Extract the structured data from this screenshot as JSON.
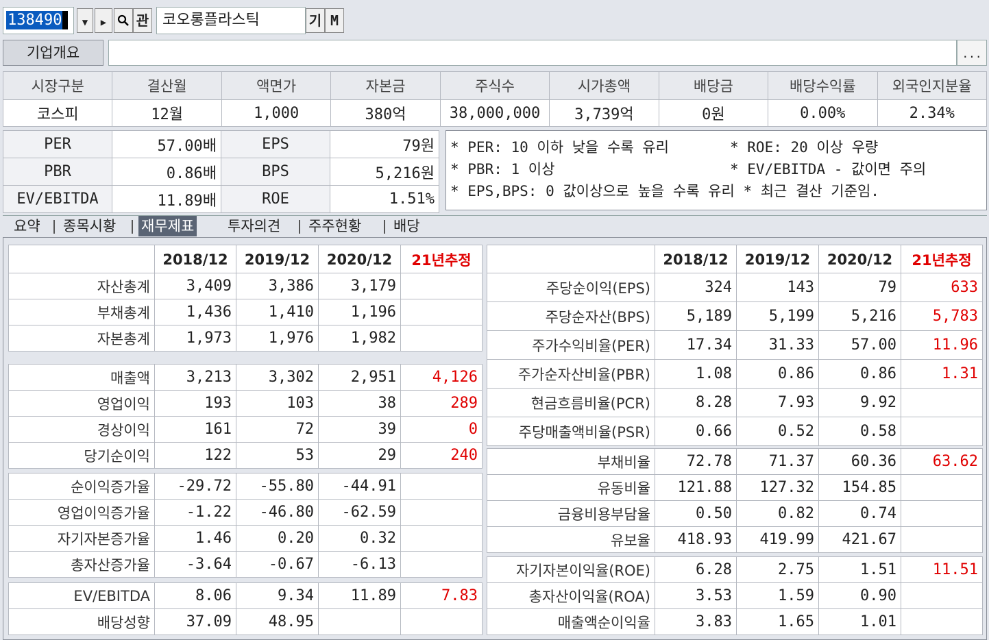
{
  "top": {
    "stock_code": "138490",
    "company_name": "코오롱플라스틱",
    "search_icon": "magnifier-icon",
    "btn_gwan": "관",
    "btn_gi": "기",
    "btn_m": "M"
  },
  "corp": {
    "label": "기업개요",
    "value": "",
    "more": "..."
  },
  "market": {
    "headers": [
      "시장구분",
      "결산월",
      "액면가",
      "자본금",
      "주식수",
      "시가총액",
      "배당금",
      "배당수익률",
      "외국인지분율"
    ],
    "values": [
      "코스피",
      "12월",
      "1,000",
      "380억",
      "38,000,000",
      "3,739억",
      "0원",
      "0.00%",
      "2.34%"
    ]
  },
  "valuation": [
    {
      "l1": "PER",
      "v1": "57.00배",
      "l2": "EPS",
      "v2": "79원"
    },
    {
      "l1": "PBR",
      "v1": "0.86배",
      "l2": "BPS",
      "v2": "5,216원"
    },
    {
      "l1": "EV/EBITDA",
      "v1": "11.89배",
      "l2": "ROE",
      "v2": "1.51%"
    }
  ],
  "notes": {
    "n1": "* PER: 10 이하 낮을 수록 유리",
    "n2": "* ROE: 20 이상 우량",
    "n3": "* PBR: 1 이상",
    "n4": "* EV/EBITDA - 값이면 주의",
    "n5": "* EPS,BPS: 0 값이상으로 높을 수록 유리 * 최근 결산 기준임."
  },
  "tabs": [
    "요약",
    "종목시황",
    "재무제표",
    "투자의견",
    "주주현황",
    "배당"
  ],
  "left": {
    "headers": [
      "",
      "2018/12",
      "2019/12",
      "2020/12",
      "21년추정"
    ],
    "g1": [
      [
        "자산총계",
        "3,409",
        "3,386",
        "3,179",
        ""
      ],
      [
        "부채총계",
        "1,436",
        "1,410",
        "1,196",
        ""
      ],
      [
        "자본총계",
        "1,973",
        "1,976",
        "1,982",
        ""
      ]
    ],
    "g2": [
      [
        "매출액",
        "3,213",
        "3,302",
        "2,951",
        "4,126"
      ],
      [
        "영업이익",
        "193",
        "103",
        "38",
        "289"
      ],
      [
        "경상이익",
        "161",
        "72",
        "39",
        "0"
      ],
      [
        "당기순이익",
        "122",
        "53",
        "29",
        "240"
      ]
    ],
    "g3": [
      [
        "순이익증가율",
        "-29.72",
        "-55.80",
        "-44.91",
        ""
      ],
      [
        "영업이익증가율",
        "-1.22",
        "-46.80",
        "-62.59",
        ""
      ],
      [
        "자기자본증가율",
        "1.46",
        "0.20",
        "0.32",
        ""
      ],
      [
        "총자산증가율",
        "-3.64",
        "-0.67",
        "-6.13",
        ""
      ]
    ],
    "g4": [
      [
        "EV/EBITDA",
        "8.06",
        "9.34",
        "11.89",
        "7.83"
      ],
      [
        "배당성향",
        "37.09",
        "48.95",
        "",
        ""
      ]
    ]
  },
  "right": {
    "headers": [
      "",
      "2018/12",
      "2019/12",
      "2020/12",
      "21년추정"
    ],
    "g1": [
      [
        "주당순이익(EPS)",
        "324",
        "143",
        "79",
        "633"
      ],
      [
        "주당순자산(BPS)",
        "5,189",
        "5,199",
        "5,216",
        "5,783"
      ],
      [
        "주가수익비율(PER)",
        "17.34",
        "31.33",
        "57.00",
        "11.96"
      ],
      [
        "주가순자산비율(PBR)",
        "1.08",
        "0.86",
        "0.86",
        "1.31"
      ],
      [
        "현금흐름비율(PCR)",
        "8.28",
        "7.93",
        "9.92",
        ""
      ],
      [
        "주당매출액비율(PSR)",
        "0.66",
        "0.52",
        "0.58",
        ""
      ]
    ],
    "g2": [
      [
        "부채비율",
        "72.78",
        "71.37",
        "60.36",
        "63.62"
      ],
      [
        "유동비율",
        "121.88",
        "127.32",
        "154.85",
        ""
      ],
      [
        "금융비용부담율",
        "0.50",
        "0.82",
        "0.74",
        ""
      ],
      [
        "유보율",
        "418.93",
        "419.99",
        "421.67",
        ""
      ]
    ],
    "g3": [
      [
        "자기자본이익율(ROE)",
        "6.28",
        "2.75",
        "1.51",
        "11.51"
      ],
      [
        "총자산이익율(ROA)",
        "3.53",
        "1.59",
        "0.90",
        ""
      ],
      [
        "매출액순이익율",
        "3.83",
        "1.65",
        "1.01",
        ""
      ]
    ]
  }
}
